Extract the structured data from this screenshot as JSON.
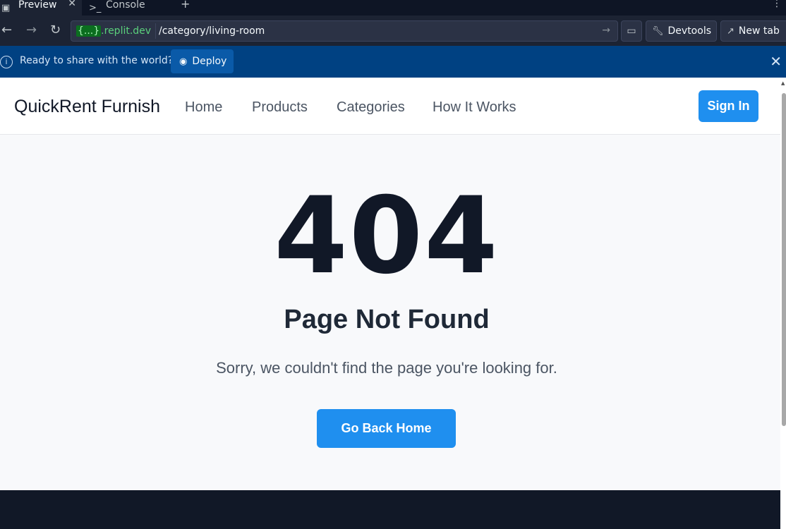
{
  "tabs": [
    {
      "label": "Preview",
      "icon": "monitor-icon"
    },
    {
      "label": "Console",
      "icon": "terminal-icon"
    }
  ],
  "address": {
    "host_brace": "{...}",
    "host_suffix": ".replit.dev",
    "path": "/category/living-room"
  },
  "toolbar": {
    "devtools_label": "Devtools",
    "newtab_label": "New tab"
  },
  "banner": {
    "text": "Ready to share with the world?",
    "deploy_label": "Deploy"
  },
  "site": {
    "brand": "QuickRent Furnish",
    "nav": [
      "Home",
      "Products",
      "Categories",
      "How It Works"
    ],
    "signin_label": "Sign In"
  },
  "error": {
    "code": "404",
    "title": "Page Not Found",
    "message": "Sorry, we couldn't find the page you're looking for.",
    "button_label": "Go Back Home"
  },
  "colors": {
    "accent": "#1f8fef",
    "banner": "#004182",
    "heading": "#111827",
    "footer": "#111827"
  }
}
